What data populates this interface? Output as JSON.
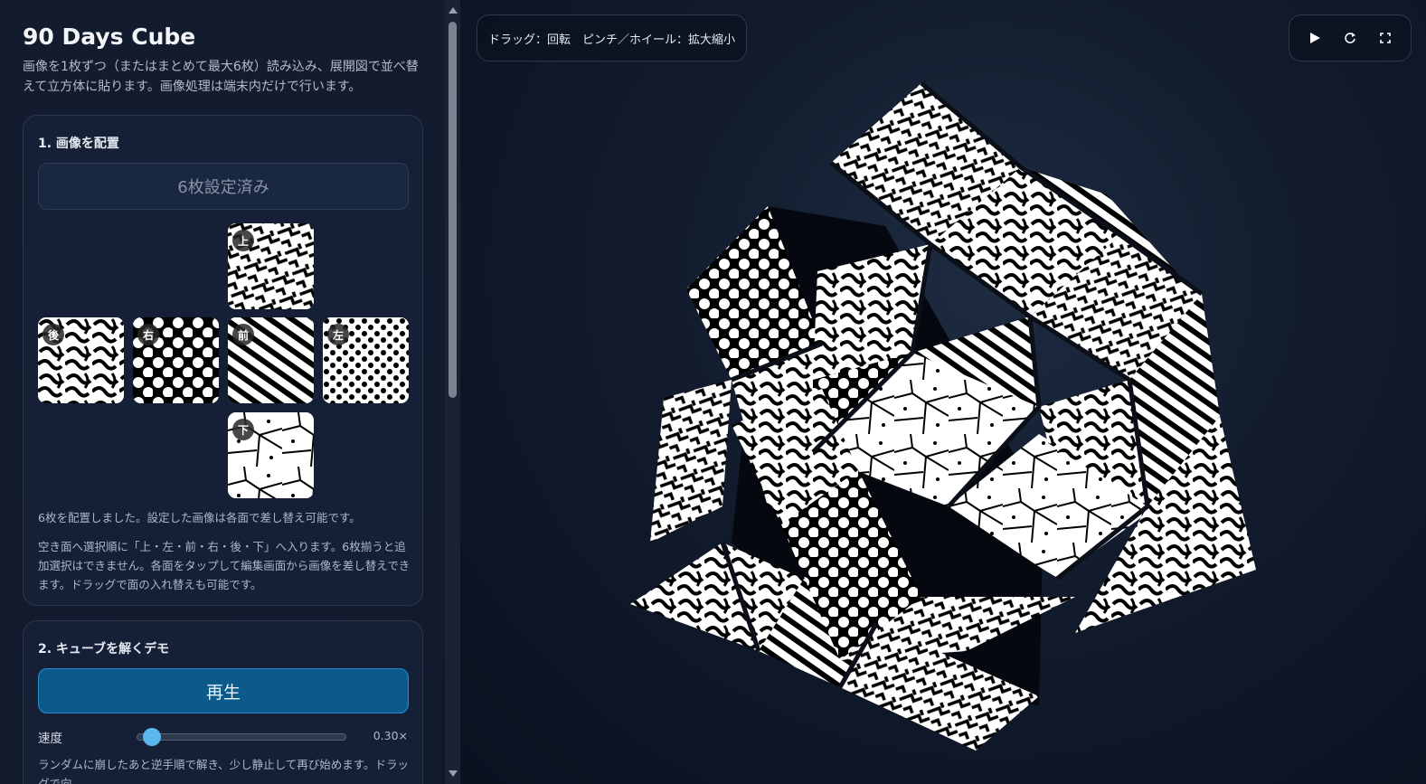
{
  "app": {
    "title": "90 Days Cube",
    "description": "画像を1枚ずつ（またはまとめて最大6枚）読み込み、展開図で並べ替えて立方体に貼ります。画像処理は端末内だけで行います。"
  },
  "panel1": {
    "title": "1. 画像を配置",
    "status_button": "6枚設定済み",
    "faces": {
      "top": "上",
      "back": "後",
      "right": "右",
      "front": "前",
      "left": "左",
      "bottom": "下"
    },
    "note1": "6枚を配置しました。設定した画像は各面で差し替え可能です。",
    "note2": "空き面へ選択順に「上・左・前・右・後・下」へ入ります。6枚揃うと追加選択はできません。各面をタップして編集画面から画像を差し替えできます。ドラッグで面の入れ替えも可能です。"
  },
  "panel2": {
    "title": "2. キューブを解くデモ",
    "play_button": "再生",
    "speed_label": "速度",
    "speed_value": "0.30×",
    "speed_fraction": 0.07,
    "note": "ランダムに崩したあと逆手順で解き、少し静止して再び始めます。ドラッグで向"
  },
  "stage": {
    "hint": "ドラッグ：回転　ピンチ／ホイール：拡大縮小",
    "controls": {
      "play_icon": "play-icon",
      "reset_icon": "reset-icon",
      "fullscreen_icon": "fullscreen-icon"
    }
  },
  "colors": {
    "accent": "#0b5a8a",
    "slider": "#5bb8ee",
    "panel_bg": "#152036"
  }
}
